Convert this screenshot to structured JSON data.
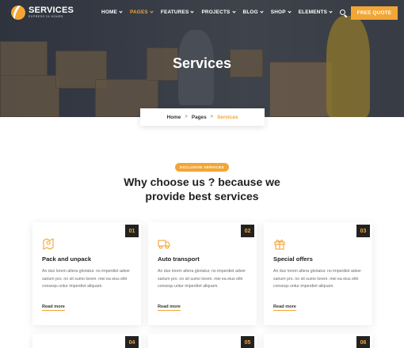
{
  "header": {
    "logo_name": "SERVICES",
    "logo_tagline": "EXPRESS 24 HOURS",
    "nav": [
      {
        "label": "HOME",
        "active": false
      },
      {
        "label": "PAGES",
        "active": true
      },
      {
        "label": "FEATURES",
        "active": false
      },
      {
        "label": "PROJECTS",
        "active": false
      },
      {
        "label": "BLOG",
        "active": false
      },
      {
        "label": "SHOP",
        "active": false
      },
      {
        "label": "ELEMENTS",
        "active": false
      }
    ],
    "quote_button": "FREE QUOTE"
  },
  "hero": {
    "title": "Services"
  },
  "breadcrumb": {
    "home": "Home",
    "pages": "Pages",
    "current": "Services",
    "separator": ">"
  },
  "section": {
    "badge": "EXCLUSIVE SERVICES",
    "heading_line1": "Why choose us ? because we",
    "heading_line2": "provide best services"
  },
  "cards": [
    {
      "num": "01",
      "icon": "map-pin-icon",
      "title": "Pack and unpack",
      "desc": "An duo lorem altera gloriatur. no imperdiet adver sarium pro. no sit sumo lorem. mei ea eius elitr consequ untur imperdiet aliquam.",
      "link": "Read more"
    },
    {
      "num": "02",
      "icon": "truck-icon",
      "title": "Auto transport",
      "desc": "An duo lorem altera gloriatur. no imperdiet adver sarium pro. no sit sumo lorem. mei ea eius elitr consequ untur imperdiet aliquam.",
      "link": "Read more"
    },
    {
      "num": "03",
      "icon": "gift-box-icon",
      "title": "Special offers",
      "desc": "An duo lorem altera gloriatur. no imperdiet adver sarium pro. no sit sumo lorem. mei ea eius elitr consequ untur imperdiet aliquam.",
      "link": "Read more"
    },
    {
      "num": "04"
    },
    {
      "num": "05"
    },
    {
      "num": "06"
    }
  ],
  "colors": {
    "accent": "#f3a535",
    "dark": "#222222",
    "text_muted": "#6b6b6b"
  }
}
